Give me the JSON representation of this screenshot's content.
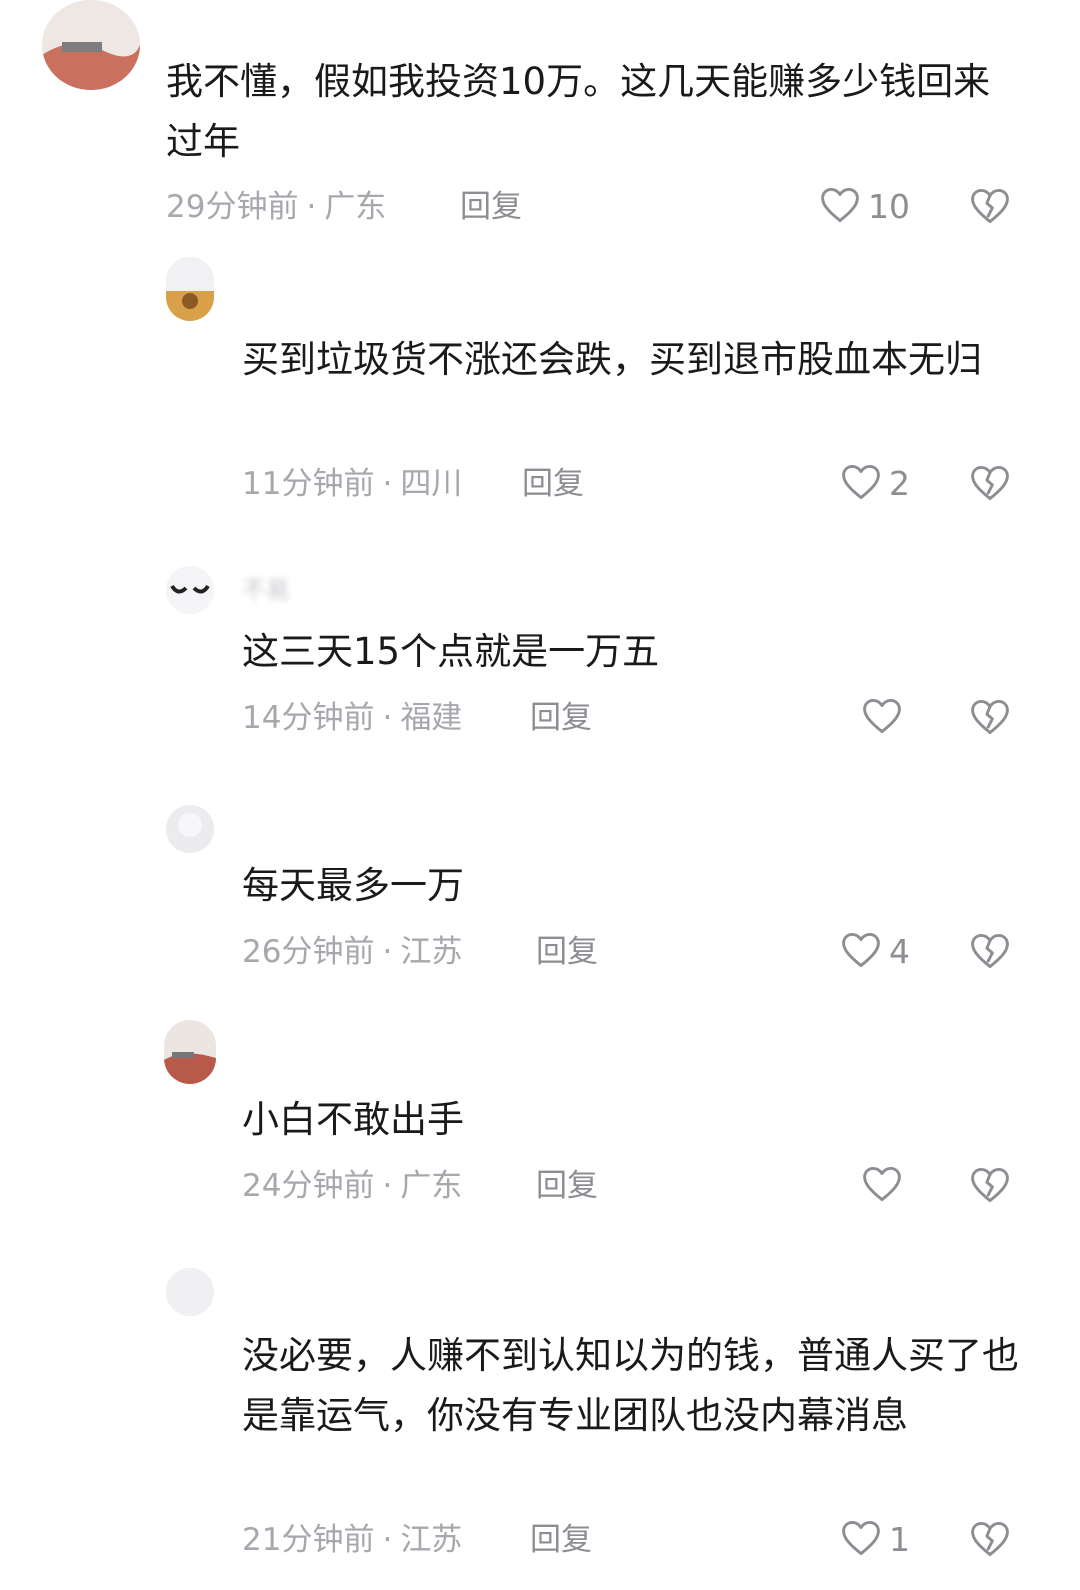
{
  "comments": [
    {
      "username": "",
      "text": "我不懂，假如我投资10万。这几天能赚多少钱回来过年",
      "time": "29分钟前",
      "location": "广东",
      "reply_label": "回复",
      "likes": "10",
      "avatar_color": "#c9705f"
    },
    {
      "username": "",
      "text": "买到垃圾货不涨还会跌，买到退市股血本无归",
      "time": "11分钟前",
      "location": "四川",
      "reply_label": "回复",
      "likes": "2",
      "avatar_color": "#d9a04a"
    },
    {
      "username": "不易",
      "text": "这三天15个点就是一万五",
      "time": "14分钟前",
      "location": "福建",
      "reply_label": "回复",
      "likes": "",
      "avatar_color": "#f2f2f4"
    },
    {
      "username": "",
      "text": "每天最多一万",
      "time": "26分钟前",
      "location": "江苏",
      "reply_label": "回复",
      "likes": "4",
      "avatar_color": "#e4e4e8"
    },
    {
      "username": "",
      "text": "小白不敢出手",
      "time": "24分钟前",
      "location": "广东",
      "reply_label": "回复",
      "likes": "",
      "avatar_color": "#b85a4a"
    },
    {
      "username": "",
      "text": "没必要，人赚不到认知以为的钱，普通人买了也是靠运气，你没有专业团队也没内幕消息",
      "time": "21分钟前",
      "location": "江苏",
      "reply_label": "回复",
      "likes": "1",
      "avatar_color": "#f0f0f2"
    }
  ],
  "meta_separator": "·",
  "colors": {
    "text": "#1a1a1a",
    "meta": "#a7a7ad",
    "icon": "#8d8d93",
    "background": "#ffffff"
  }
}
